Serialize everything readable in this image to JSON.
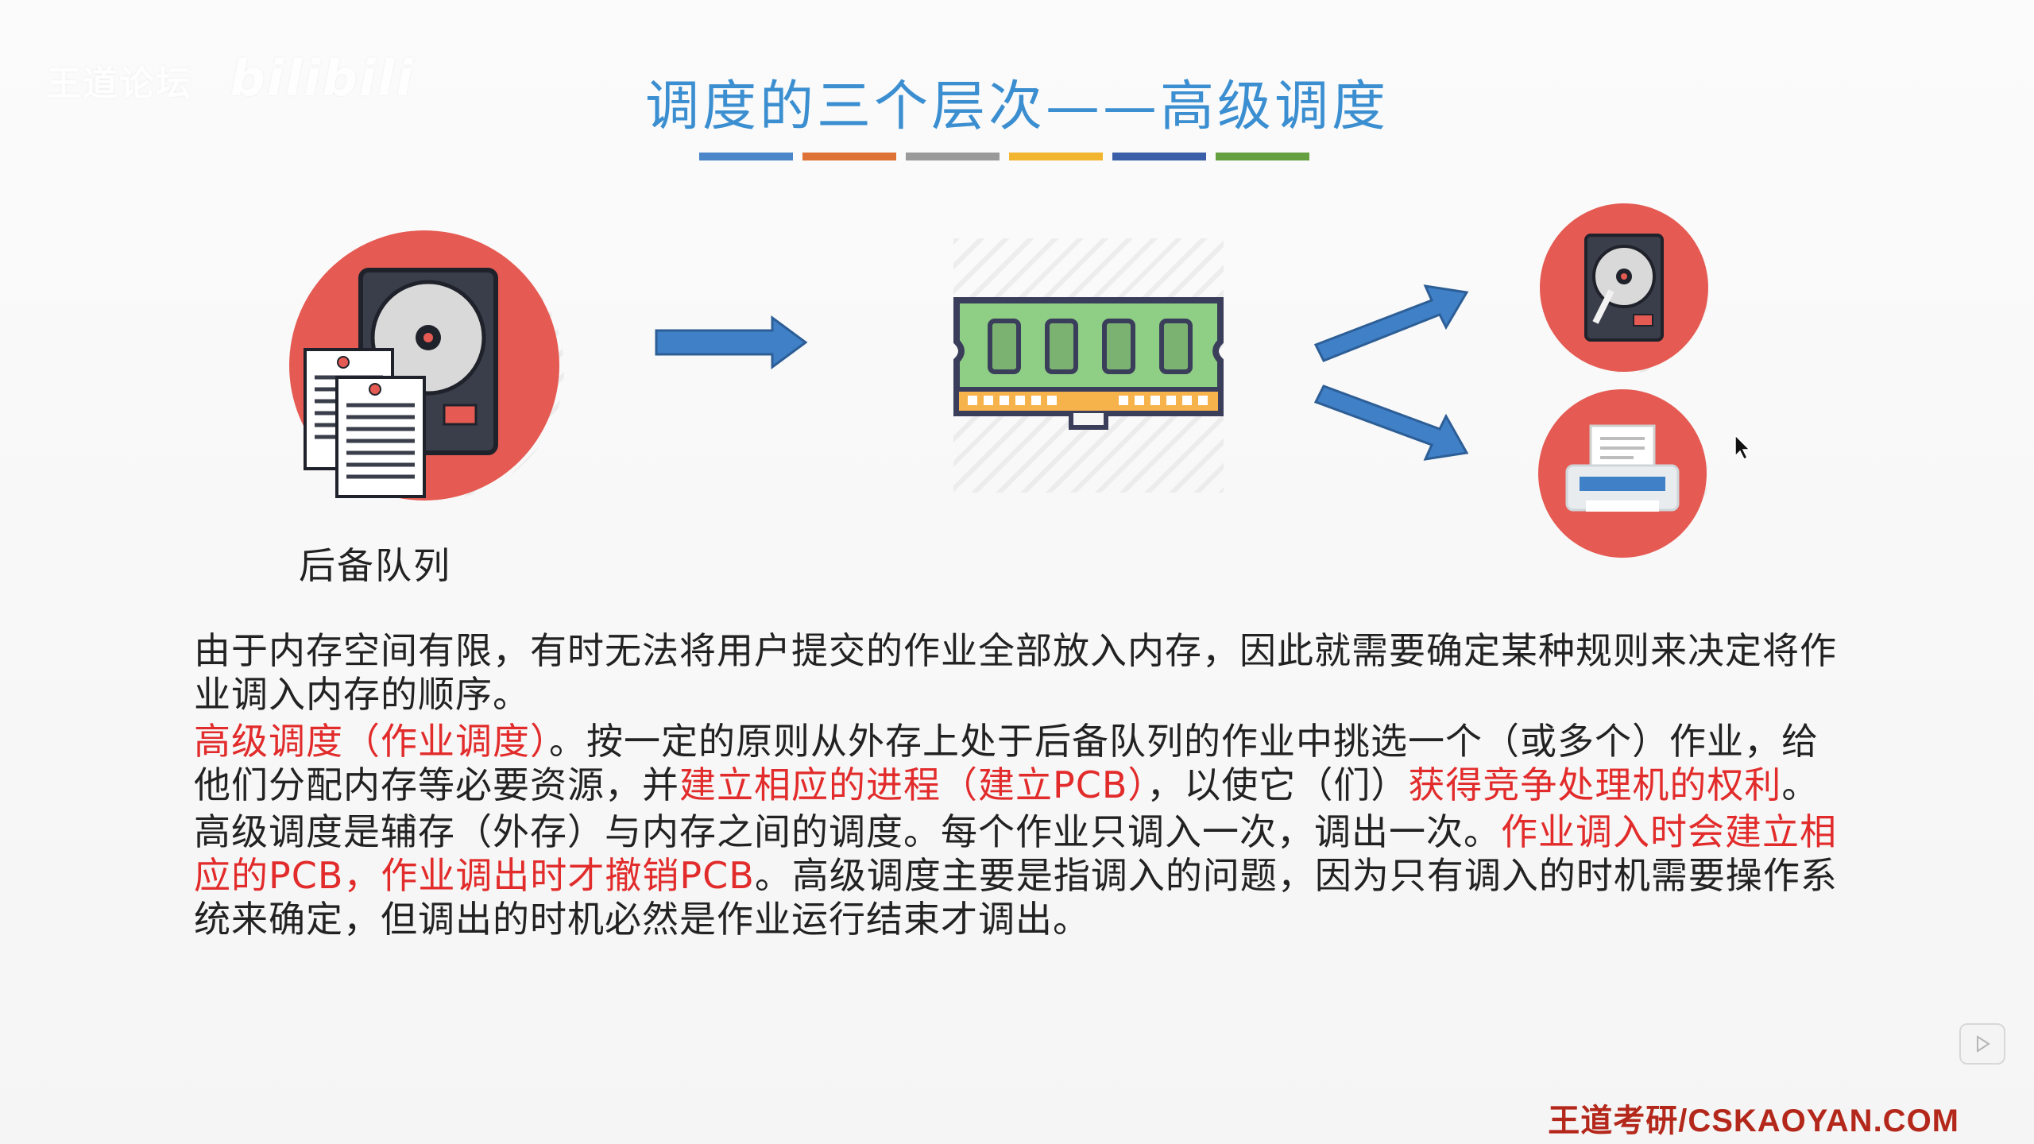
{
  "watermark": {
    "text": "王道论坛",
    "logo": "bilibili"
  },
  "title": "调度的三个层次——高级调度",
  "title_bar_colors": [
    "#4a86c8",
    "#de7135",
    "#9a9a9a",
    "#f2b530",
    "#3a5fa8",
    "#65a040"
  ],
  "diagram": {
    "backlog_label": "后备队列",
    "icons": [
      "hard-disk-with-documents-icon",
      "right-arrow-icon",
      "memory-ram-icon",
      "up-right-arrow-icon",
      "down-right-arrow-icon",
      "hard-disk-icon",
      "printer-icon"
    ]
  },
  "paragraphs": [
    {
      "segments": [
        {
          "text": "由于内存空间有限，有时无法将用户提交的作业全部放入内存，因此就需要确定某种规则来决定将作业调入内存的顺序。",
          "red": false
        }
      ]
    },
    {
      "segments": [
        {
          "text": "高级调度（作业调度）",
          "red": true
        },
        {
          "text": "。按一定的原则从外存上处于后备队列的作业中挑选一个（或多个）作业，给他们分配内存等必要资源，并",
          "red": false
        },
        {
          "text": "建立相应的进程（建立PCB）",
          "red": true
        },
        {
          "text": "，以使它（们）",
          "red": false
        },
        {
          "text": "获得竞争处理机的权利",
          "red": true
        },
        {
          "text": "。",
          "red": false
        }
      ]
    },
    {
      "segments": [
        {
          "text": "高级调度是辅存（外存）与内存之间的调度。每个作业只调入一次，调出一次。",
          "red": false
        },
        {
          "text": "作业调入时会建立相应的PCB，作业调出时才撤销PCB",
          "red": true
        },
        {
          "text": "。高级调度主要是指调入的问题，因为只有调入的时机需要操作系统来确定，但调出的时机必然是作业运行结束才调出。",
          "red": false
        }
      ]
    }
  ],
  "footer": "王道考研/CSKAOYAN.COM",
  "colors": {
    "title": "#3b8fd1",
    "highlight": "#e22b2b",
    "circle": "#e55b53",
    "arrow": "#3f80c7",
    "footer": "#b4271b"
  }
}
